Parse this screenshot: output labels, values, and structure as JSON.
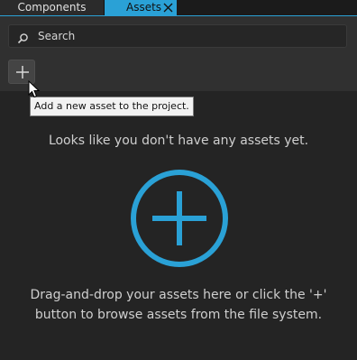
{
  "tabs": [
    {
      "label": "Components",
      "active": false
    },
    {
      "label": "Assets",
      "active": true
    }
  ],
  "search": {
    "placeholder": "Search",
    "icon": "search-icon"
  },
  "toolbar": {
    "add_button_icon": "plus-icon"
  },
  "tooltip": {
    "text": "Add a new asset to the project."
  },
  "empty_state": {
    "title": "Looks like you don't have any assets yet.",
    "description_line1": "Drag-and-drop your assets here or click the '+'",
    "description_line2": "button to browse assets from the file system.",
    "icon": "add-circle-icon"
  },
  "colors": {
    "accent": "#2aa1d6",
    "background": "#242424",
    "toolbar": "#303030"
  }
}
